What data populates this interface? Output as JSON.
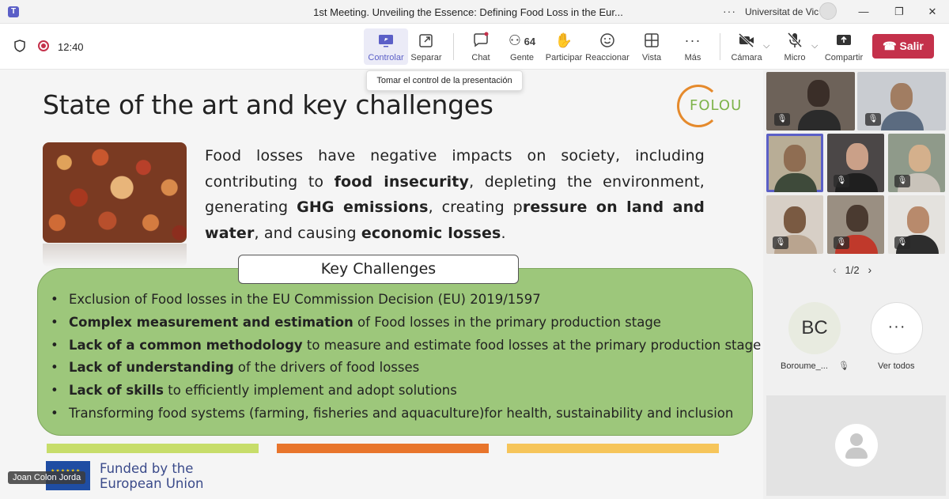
{
  "window": {
    "title": "1st Meeting. Unveiling the Essence: Defining Food Loss in the Eur...",
    "org": "Universitat de Vic",
    "more": "···",
    "minimize": "—",
    "restore": "❐",
    "close": "✕"
  },
  "meeting_bar": {
    "timer": "12:40",
    "buttons": [
      {
        "label": "Controlar",
        "icon": "share-screen-icon"
      },
      {
        "label": "Separar",
        "icon": "pop-out-icon"
      },
      {
        "label": "Chat",
        "icon": "chat-icon"
      },
      {
        "label": "Gente",
        "icon": "people-icon",
        "count": "64"
      },
      {
        "label": "Participar",
        "icon": "raise-hand-icon"
      },
      {
        "label": "Reaccionar",
        "icon": "react-icon"
      },
      {
        "label": "Vista",
        "icon": "view-icon"
      },
      {
        "label": "Más",
        "icon": "more-icon"
      },
      {
        "label": "Cámara",
        "icon": "camera-off-icon"
      },
      {
        "label": "Micro",
        "icon": "mic-off-icon"
      },
      {
        "label": "Compartir",
        "icon": "share-icon"
      }
    ],
    "leave_label": "Salir",
    "colors": {
      "accent": "#5b5fc7",
      "leave": "#c4314b"
    }
  },
  "tooltip": "Tomar el control de la presentación",
  "slide": {
    "title": "State of the art and key challenges",
    "logo_text": "FOLOU",
    "intro": {
      "p1": "Food losses have negative impacts on society, including contributing to ",
      "b1": "food insecurity",
      "p2": ", depleting the environment, generating ",
      "b2": "GHG emissions",
      "p3": ", creating p",
      "b3": "ressure on land and water",
      "p4": ", and causing ",
      "b4": "economic losses",
      "p5": "."
    },
    "challenges_header": "Key Challenges",
    "bullet": "•",
    "challenges": [
      {
        "bold": "",
        "text": "Exclusion of Food losses in the EU Commission Decision (EU) 2019/1597"
      },
      {
        "bold": "Complex measurement and estimation",
        "text": " of Food losses in the primary production stage"
      },
      {
        "bold": "Lack of a common methodology",
        "text": " to measure and estimate food losses at the primary production stage"
      },
      {
        "bold": "Lack of understanding",
        "text": " of the drivers of food losses"
      },
      {
        "bold": "Lack of skills",
        "text": " to efficiently implement and adopt solutions"
      },
      {
        "bold": "",
        "text": "Transforming food systems (farming, fisheries and aquaculture)for health, sustainability and inclusion"
      }
    ],
    "bar_colors": [
      "#c7dd6a",
      "#e8752c",
      "#f6c55a"
    ],
    "funded_line1": "Funded by the",
    "funded_line2": "European Union",
    "presenter": "Joan Colon Jorda"
  },
  "participants": {
    "pager": "1/2",
    "prev": "‹",
    "next": "›",
    "bc_initials": "BC",
    "bc_name": "Boroume_...",
    "more_icon": "···",
    "see_all": "Ver todos",
    "mute_glyph": "🎙"
  }
}
